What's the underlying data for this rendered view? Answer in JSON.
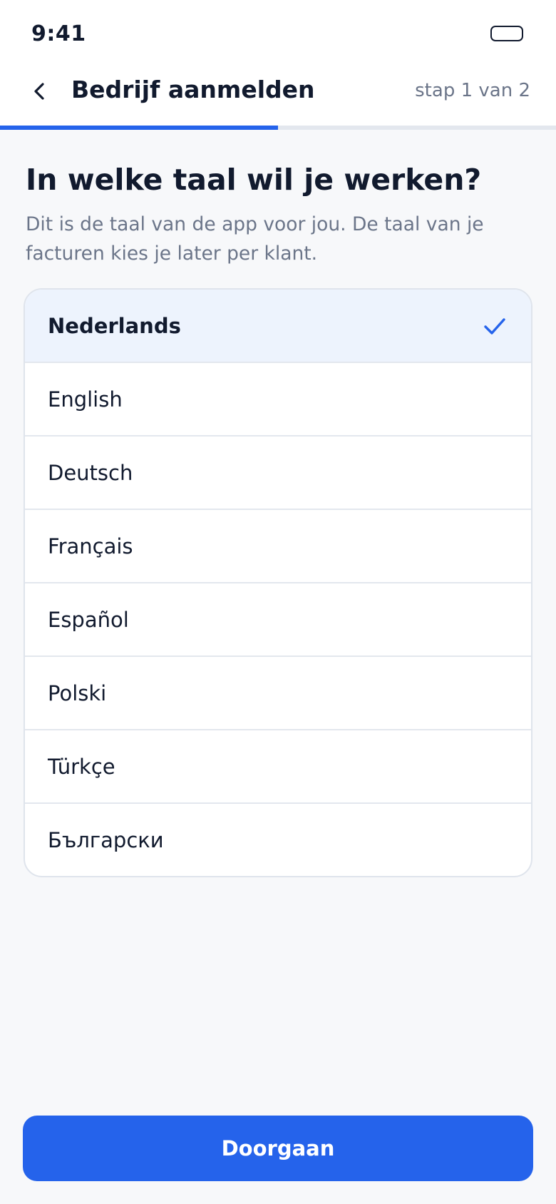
{
  "status_bar": {
    "time": "9:41"
  },
  "header": {
    "title": "Bedrijf aanmelden",
    "step": "stap 1 van 2",
    "progress_fraction": 0.5
  },
  "main": {
    "heading": "In welke taal wil je werken?",
    "subtitle": "Dit is de taal van de app voor jou. De taal van je facturen kies je later per klant."
  },
  "languages": {
    "selected_index": 0,
    "items": [
      {
        "label": "Nederlands"
      },
      {
        "label": "English"
      },
      {
        "label": "Deutsch"
      },
      {
        "label": "Français"
      },
      {
        "label": "Español"
      },
      {
        "label": "Polski"
      },
      {
        "label": "Türkçe"
      },
      {
        "label": "Български"
      }
    ]
  },
  "footer": {
    "continue_label": "Doorgaan"
  },
  "icons": {
    "back": "chevron-left-icon",
    "selected": "check-icon",
    "battery": "battery-icon"
  },
  "colors": {
    "accent": "#2563eb",
    "selected_row_bg": "#edf3fd",
    "text_primary": "#111a2e",
    "text_secondary": "#6b7589",
    "background": "#f7f8fa"
  }
}
